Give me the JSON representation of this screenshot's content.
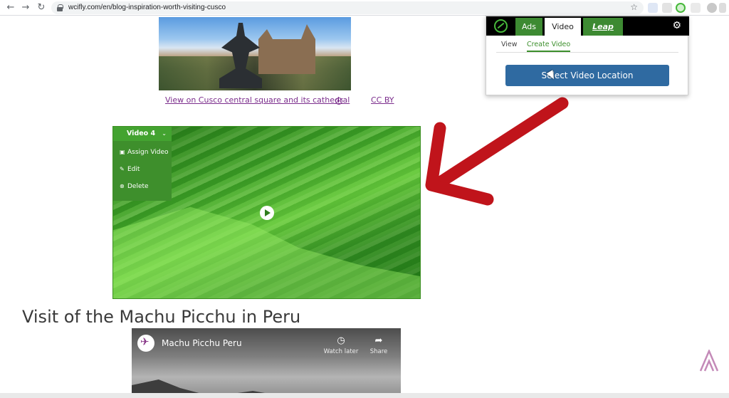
{
  "browser": {
    "url": "wcifly.com/en/blog-inspiration-worth-visiting-cusco",
    "back_glyph": "←",
    "forward_glyph": "→",
    "reload_glyph": "↻",
    "star_glyph": "☆"
  },
  "page": {
    "photo_caption": "View on Cusco central square and its cathedral",
    "license": "CC BY",
    "section_heading": "Visit of the Machu Picchu in Peru"
  },
  "video_overlay": {
    "title": "Video 4",
    "chevron": "⌄",
    "menu": [
      {
        "icon": "▣",
        "label": "Assign Video"
      },
      {
        "icon": "✎",
        "label": "Edit"
      },
      {
        "icon": "⊗",
        "label": "Delete"
      }
    ]
  },
  "youtube_embed": {
    "title": "Machu Picchu Peru",
    "watch_later": "Watch later",
    "share": "Share",
    "watch_later_glyph": "◷",
    "share_glyph": "➦"
  },
  "extension_popup": {
    "tabs": [
      "Ads",
      "Video",
      "Leap"
    ],
    "active_tab": "Video",
    "subtabs": [
      "View",
      "Create Video"
    ],
    "active_subtab": "Create Video",
    "action_button": "Select Video Location",
    "gear_glyph": "⚙"
  },
  "colors": {
    "overlay_green": "#43a330",
    "popup_button": "#2f6aa1",
    "arrow_red": "#c0141b",
    "link_purple": "#7b2d8c"
  }
}
